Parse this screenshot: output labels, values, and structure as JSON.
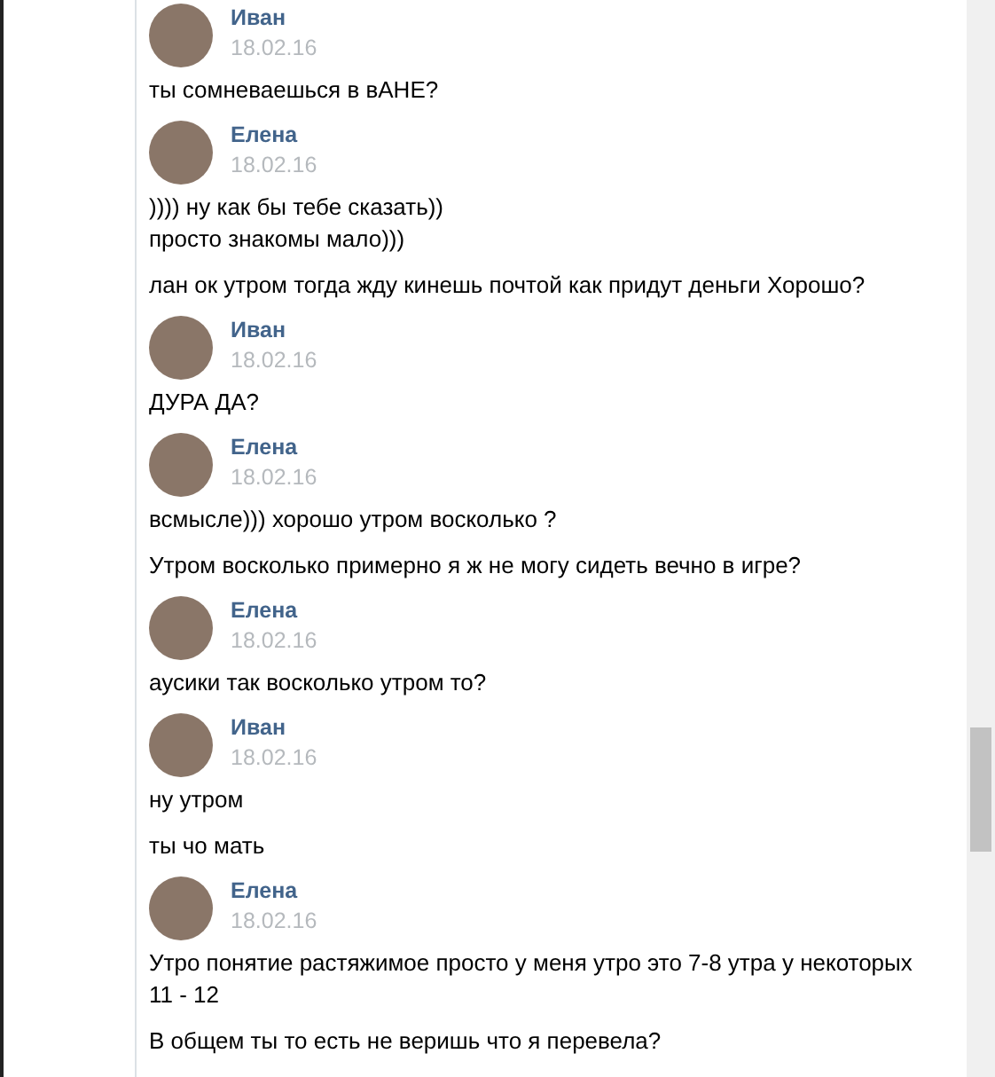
{
  "messages": [
    {
      "author": "Иван",
      "date": "18.02.16",
      "texts": [
        "ты сомневаешься в вАНЕ?"
      ]
    },
    {
      "author": "Елена",
      "date": "18.02.16",
      "texts": [
        ")))) ну как бы тебе сказать))\nпросто знакомы мало)))",
        "лан ок утром тогда жду кинешь почтой как придут деньги Хорошо?"
      ]
    },
    {
      "author": "Иван",
      "date": "18.02.16",
      "texts": [
        "ДУРА ДА?"
      ]
    },
    {
      "author": "Елена",
      "date": "18.02.16",
      "texts": [
        "всмысле))) хорошо утром восколько ?",
        "Утром восколько примерно я ж не могу сидеть вечно в игре?"
      ]
    },
    {
      "author": "Елена",
      "date": "18.02.16",
      "texts": [
        "аусики так восколько утром то?"
      ]
    },
    {
      "author": "Иван",
      "date": "18.02.16",
      "texts": [
        "ну утром",
        "ты чо мать"
      ]
    },
    {
      "author": "Елена",
      "date": "18.02.16",
      "texts": [
        "Утро понятие растяжимое просто у меня утро это 7-8 утра у некоторых 11 - 12",
        "В общем ты то есть не веришь что я перевела?"
      ]
    }
  ]
}
